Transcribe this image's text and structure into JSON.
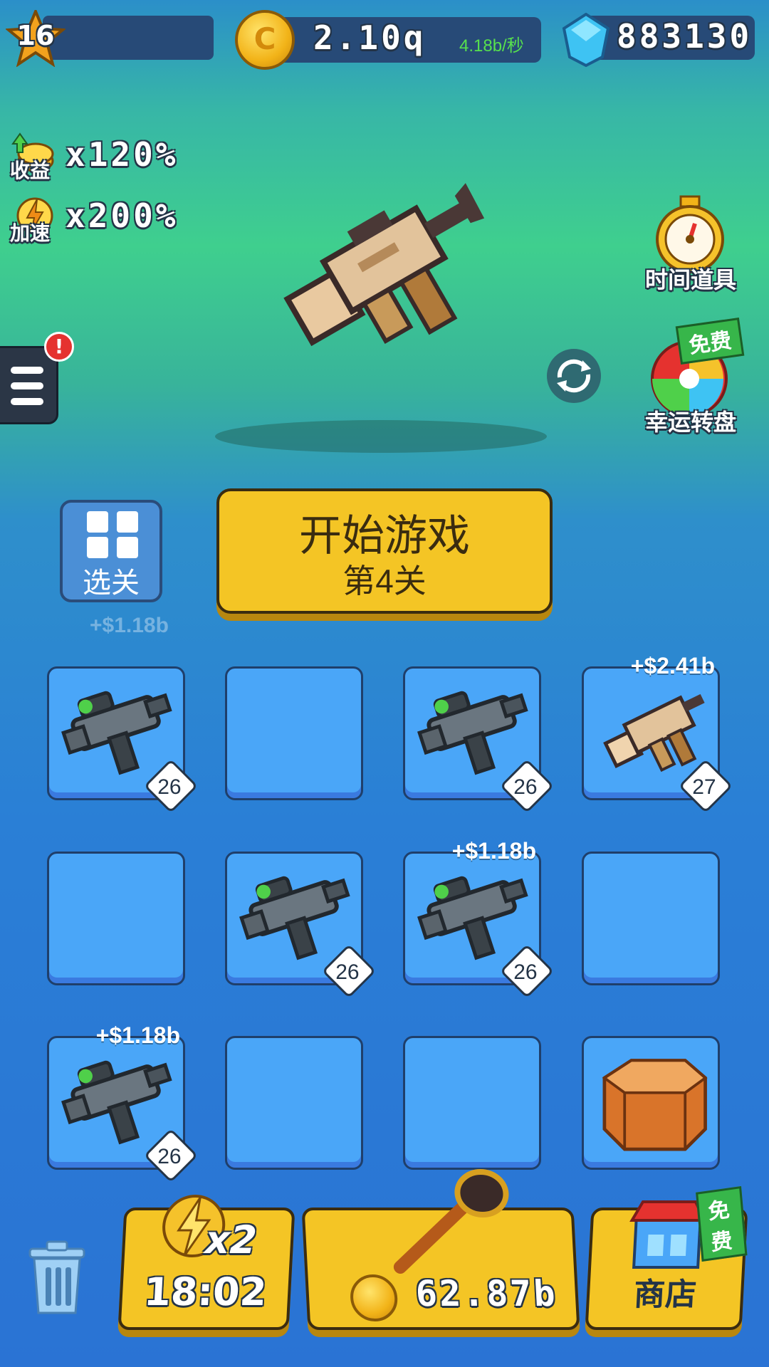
{
  "hud": {
    "level": "16",
    "coins": "2.10q",
    "coin_rate": "4.18b/秒",
    "gems": "883130"
  },
  "boosts": {
    "income_label": "收益",
    "income_value": "x120%",
    "speed_label": "加速",
    "speed_value": "x200%"
  },
  "side": {
    "alert": "!"
  },
  "right_items": {
    "time_item_label": "时间道具",
    "wheel_label": "幸运转盘",
    "wheel_tag": "免费"
  },
  "level_select": {
    "label": "选关"
  },
  "start": {
    "title": "开始游戏",
    "stage": "第4关"
  },
  "floating": {
    "top_left": "+$1.18b"
  },
  "grid": {
    "slots": [
      {
        "item": "gun",
        "level": "26"
      },
      {
        "item": "empty"
      },
      {
        "item": "gun",
        "level": "26"
      },
      {
        "item": "rifle",
        "level": "27",
        "float": "+$2.41b"
      },
      {
        "item": "empty"
      },
      {
        "item": "gun",
        "level": "26"
      },
      {
        "item": "gun",
        "level": "26",
        "float": "+$1.18b"
      },
      {
        "item": "empty"
      },
      {
        "item": "gun",
        "level": "26",
        "float": "+$1.18b"
      },
      {
        "item": "empty"
      },
      {
        "item": "empty"
      },
      {
        "item": "crate"
      }
    ]
  },
  "bottom": {
    "speed_mult": "x2",
    "speed_timer": "18:02",
    "buy_price": "62.87b",
    "shop_label": "商店",
    "shop_tag": "免费"
  },
  "colors": {
    "button_yellow": "#f4c525",
    "slot_blue": "#4aa6f8",
    "free_green": "#37b64a",
    "rate_green": "#57e04e"
  }
}
